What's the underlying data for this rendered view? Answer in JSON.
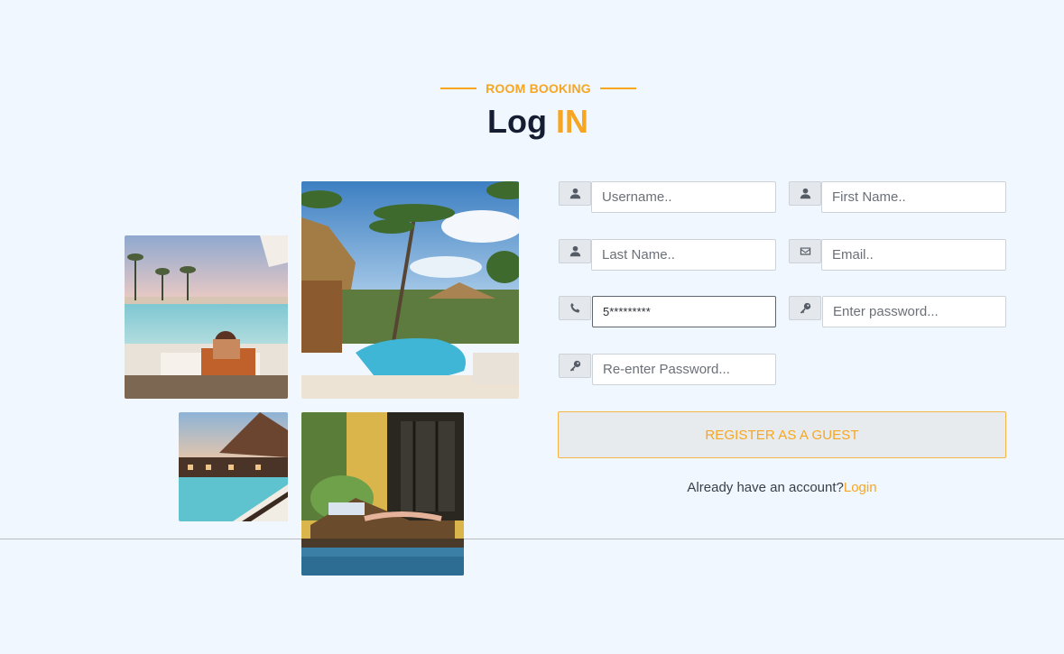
{
  "header": {
    "eyebrow": "ROOM BOOKING",
    "title_main": "Log",
    "title_accent": "IN"
  },
  "colors": {
    "accent": "#f6a623",
    "background": "#f1f7fe",
    "title": "#151d32"
  },
  "form": {
    "username": {
      "placeholder": "Username..",
      "value": "",
      "icon": "user-icon"
    },
    "first_name": {
      "placeholder": "First Name..",
      "value": "",
      "icon": "user-icon"
    },
    "last_name": {
      "placeholder": "Last Name..",
      "value": "",
      "icon": "user-icon"
    },
    "email": {
      "placeholder": "Email..",
      "value": "",
      "icon": "envelope-icon"
    },
    "phone": {
      "placeholder": "",
      "value": "5*********",
      "icon": "phone-icon"
    },
    "password": {
      "placeholder": "Enter password...",
      "value": "",
      "icon": "key-icon"
    },
    "repassword": {
      "placeholder": "Re-enter Password...",
      "value": "",
      "icon": "key-icon"
    },
    "register_label": "REGISTER AS A GUEST",
    "account_text": "Already have an account?",
    "login_link": "Login"
  },
  "gallery": [
    {
      "name": "beach-pool-photo"
    },
    {
      "name": "tropical-resort-pool-photo"
    },
    {
      "name": "poolside-deck-photo"
    },
    {
      "name": "lounge-chair-photo"
    }
  ]
}
